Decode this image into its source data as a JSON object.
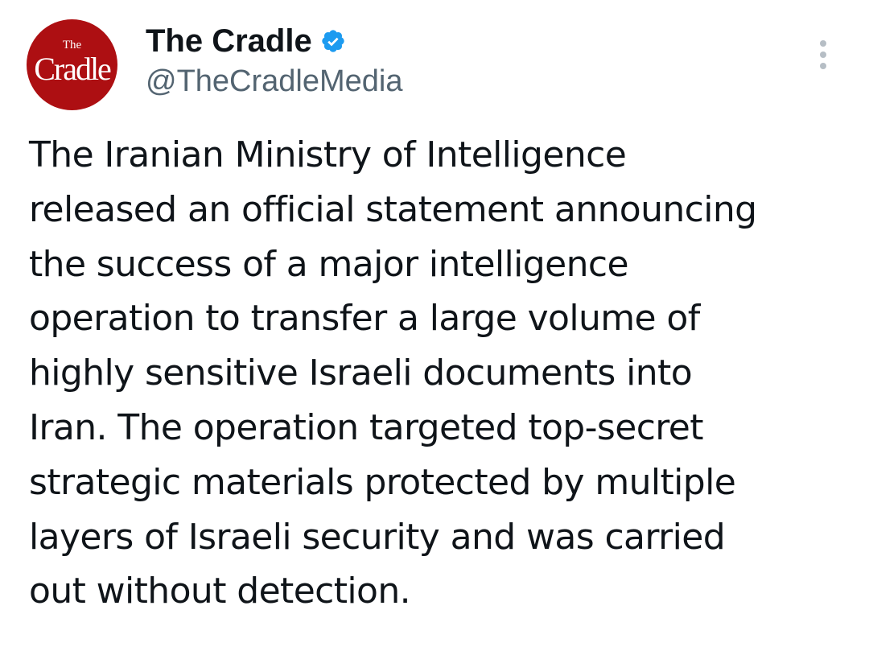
{
  "author": {
    "display_name": "The Cradle",
    "handle": "@TheCradleMedia",
    "verified": true,
    "avatar": {
      "logo_top": "The",
      "logo_main": "Cradle",
      "background_color": "#ad0f12"
    }
  },
  "tweet": {
    "text_lines": [
      "The Iranian Ministry of Intelligence",
      "released an official statement announcing",
      "the success of a major intelligence",
      "operation to transfer a large volume of",
      "highly sensitive Israeli documents into",
      "Iran. The operation targeted top-secret",
      "strategic materials protected by multiple",
      "layers of Israeli security and was carried",
      "out without detection."
    ]
  },
  "icons": {
    "verified": "verified-badge-icon",
    "more": "more-options-icon"
  },
  "colors": {
    "verified_blue": "#1d9bf0",
    "handle_gray": "#536471",
    "text": "#0f1419"
  }
}
